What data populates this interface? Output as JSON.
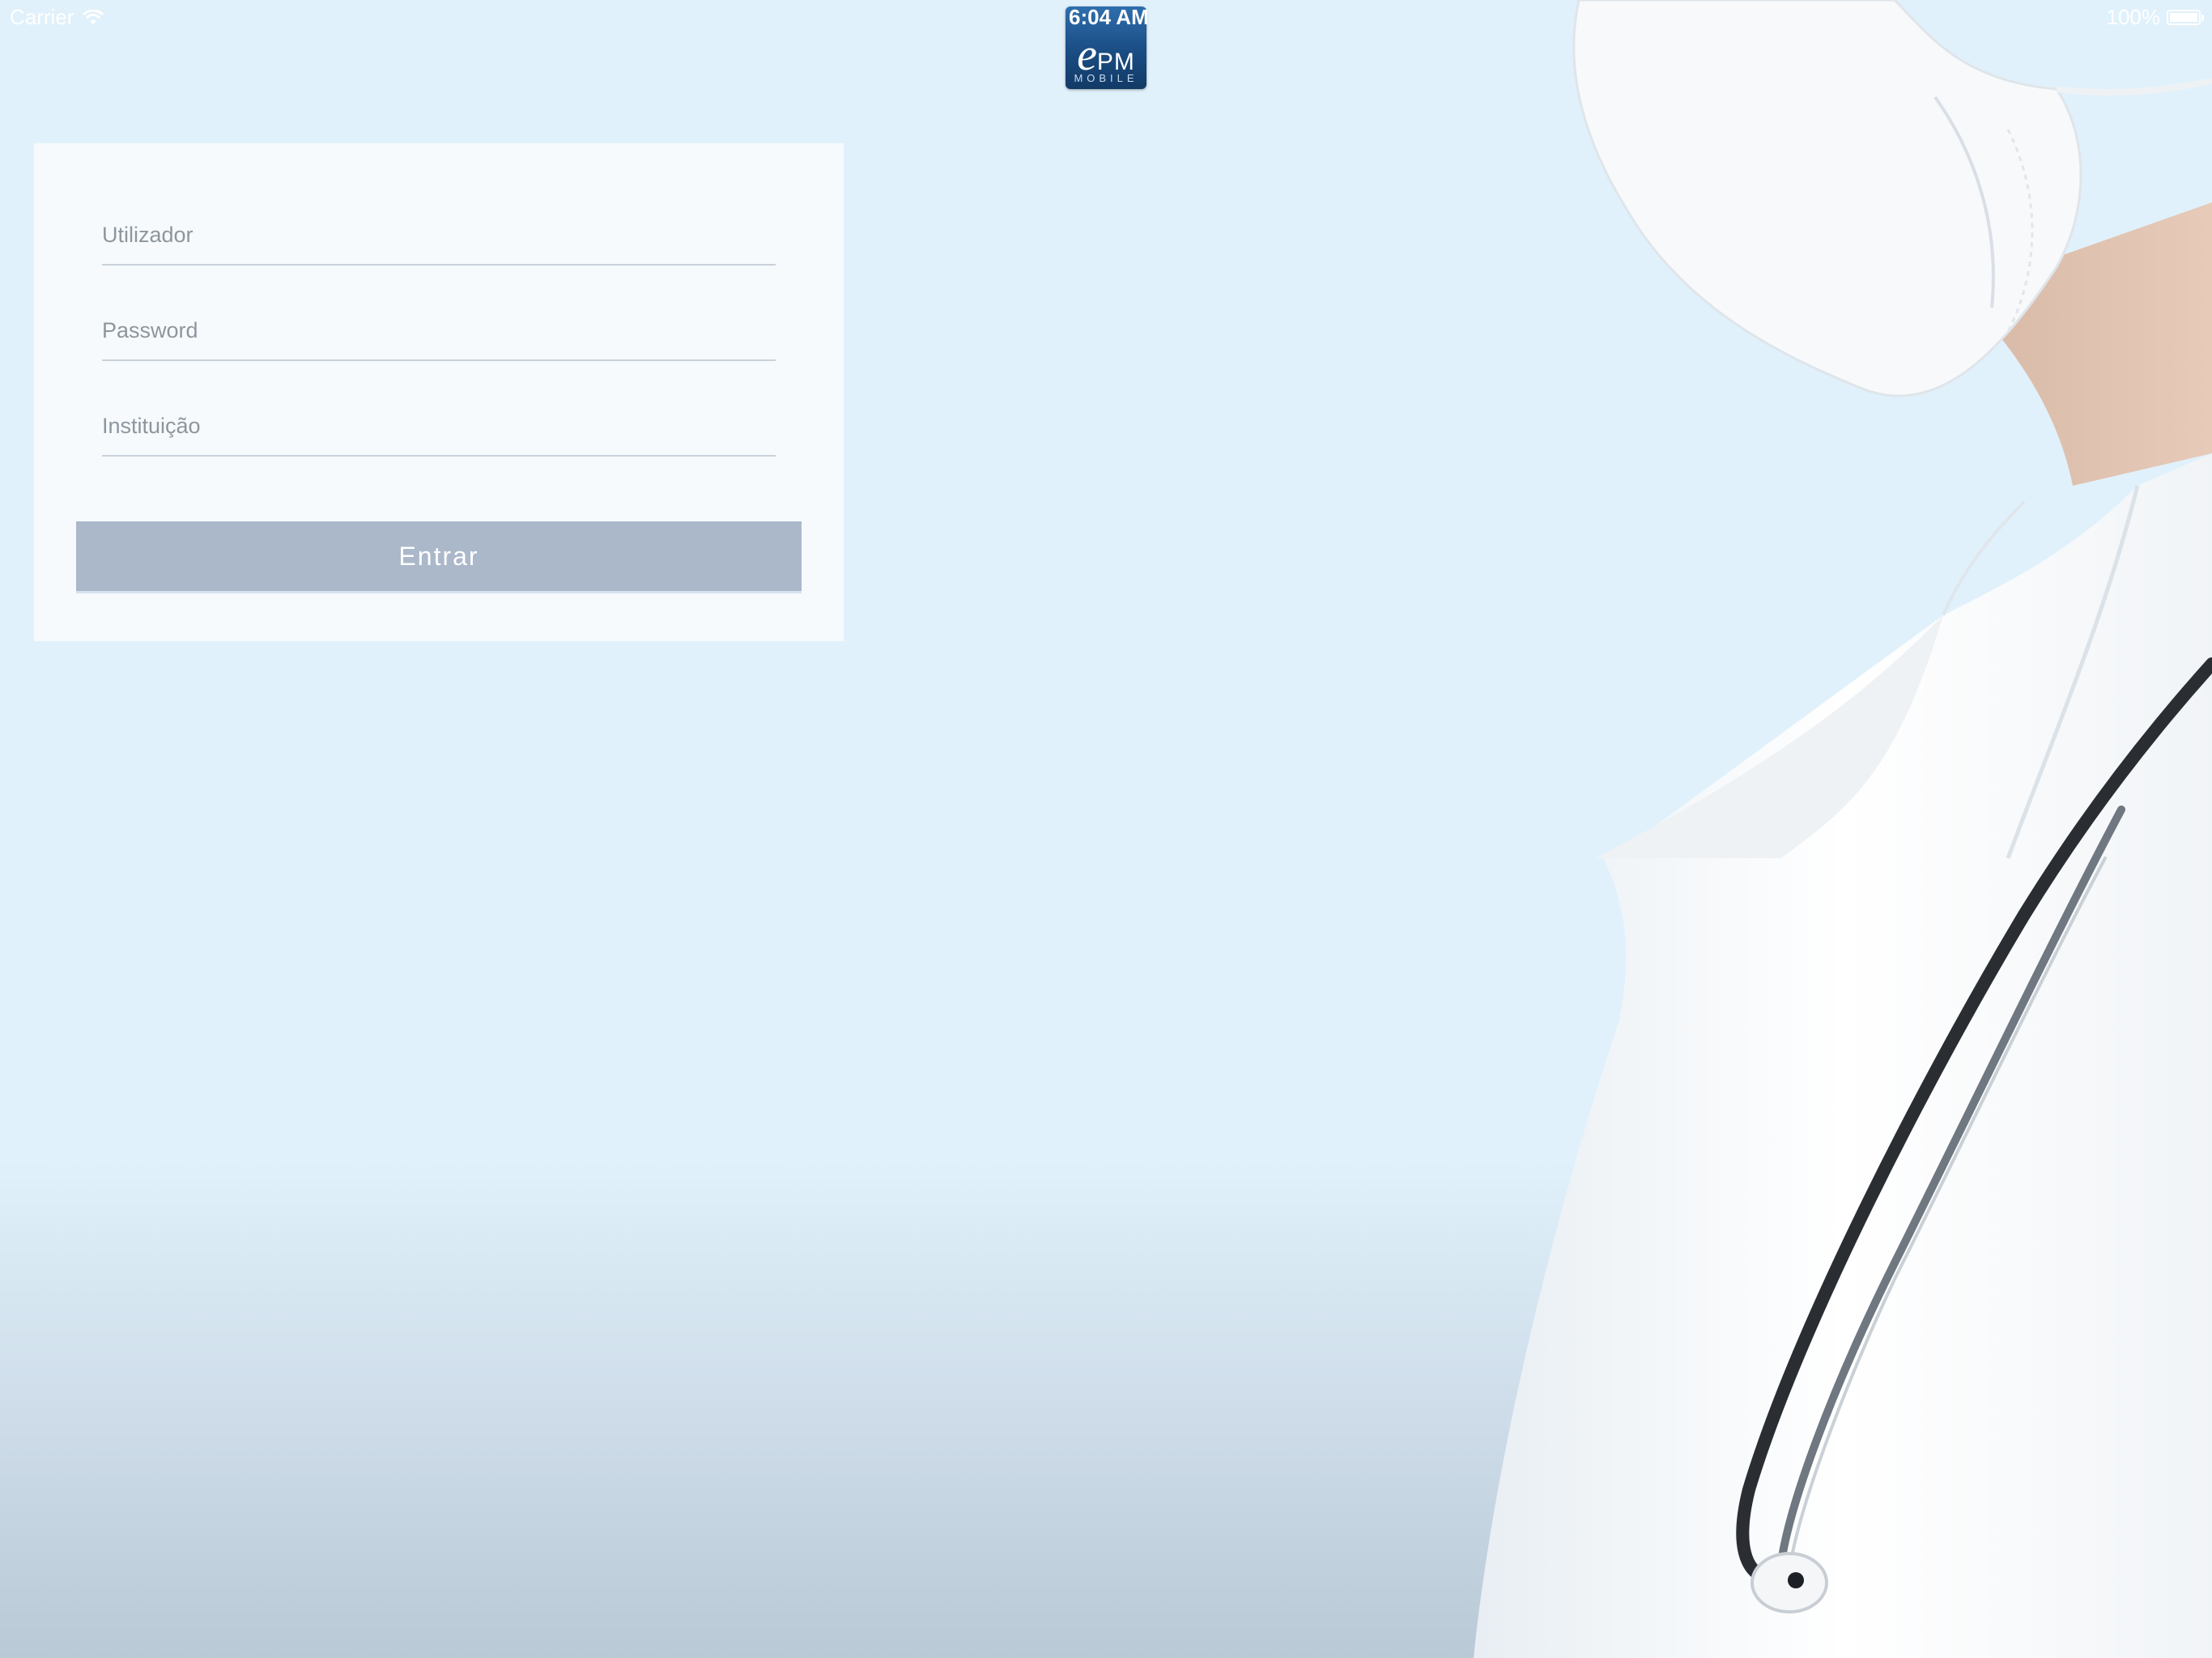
{
  "status_bar": {
    "carrier": "Carrier",
    "time": "6:04 AM",
    "battery_percent": "100%",
    "battery_level": 1.0
  },
  "app_logo": {
    "mark_e": "e",
    "mark_pm": "PM",
    "subtitle": "MOBILE",
    "colors": {
      "top": "#2f6fae",
      "bottom": "#123a66"
    }
  },
  "login_form": {
    "username": {
      "placeholder": "Utilizador",
      "value": ""
    },
    "password": {
      "placeholder": "Password",
      "value": ""
    },
    "institution": {
      "placeholder": "Instituição",
      "value": ""
    },
    "submit_label": "Entrar"
  },
  "colors": {
    "background_top": "#e0f1fb",
    "background_bottom": "#b9c9d6",
    "button": "#abb8ca",
    "card": "#f8fbfd"
  },
  "icons": [
    "wifi-icon",
    "battery-icon"
  ]
}
